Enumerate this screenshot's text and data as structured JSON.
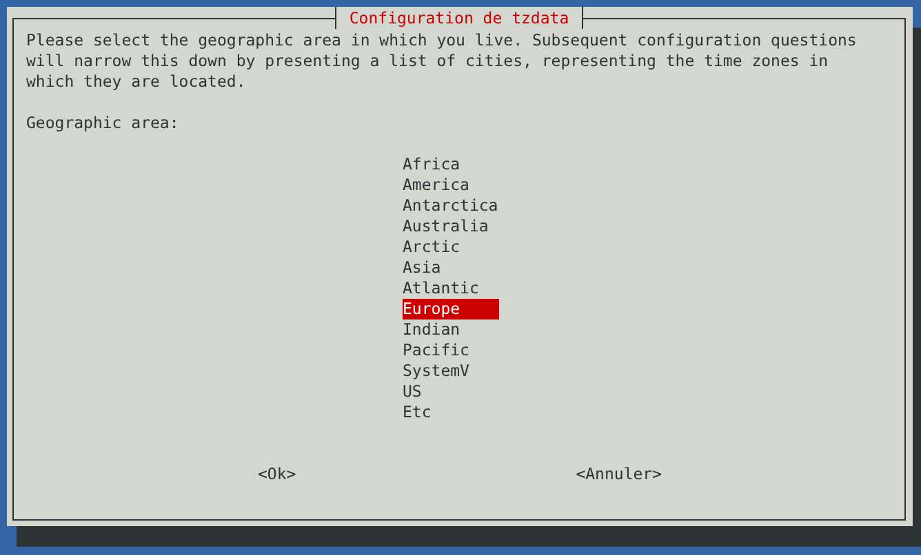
{
  "dialog": {
    "title": "Configuration de tzdata",
    "message_lines": [
      "Please select the geographic area in which you live. Subsequent configuration questions",
      "will narrow this down by presenting a list of cities, representing the time zones in",
      "which they are located."
    ],
    "prompt": "Geographic area:",
    "options": [
      {
        "label": "Africa",
        "selected": false
      },
      {
        "label": "America",
        "selected": false
      },
      {
        "label": "Antarctica",
        "selected": false
      },
      {
        "label": "Australia",
        "selected": false
      },
      {
        "label": "Arctic",
        "selected": false
      },
      {
        "label": "Asia",
        "selected": false
      },
      {
        "label": "Atlantic",
        "selected": false
      },
      {
        "label": "Europe",
        "selected": true
      },
      {
        "label": "Indian",
        "selected": false
      },
      {
        "label": "Pacific",
        "selected": false
      },
      {
        "label": "SystemV",
        "selected": false
      },
      {
        "label": "US",
        "selected": false
      },
      {
        "label": "Etc",
        "selected": false
      }
    ],
    "buttons": [
      "<Ok>",
      "<Annuler>"
    ]
  }
}
